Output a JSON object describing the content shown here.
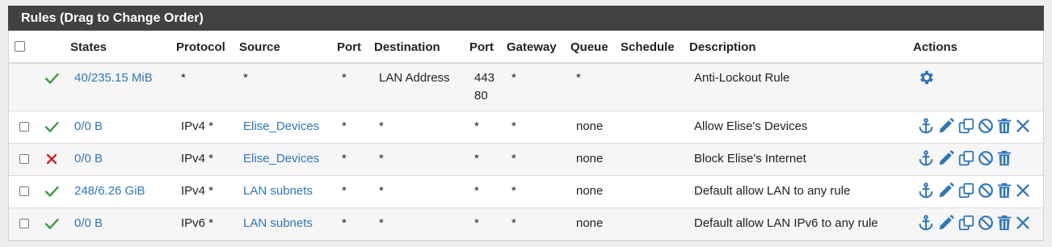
{
  "panel": {
    "title": "Rules (Drag to Change Order)"
  },
  "columns": {
    "states": "States",
    "protocol": "Protocol",
    "source": "Source",
    "port": "Port",
    "destination": "Destination",
    "dest_port": "Port",
    "gateway": "Gateway",
    "queue": "Queue",
    "schedule": "Schedule",
    "description": "Description",
    "actions": "Actions"
  },
  "colors": {
    "header_bg": "#424242",
    "link": "#3176b5",
    "pass": "#3c9a3c",
    "block": "#cc2222",
    "action_icon": "#3176b5"
  },
  "rows": [
    {
      "status": "pass",
      "states": "40/235.15 MiB",
      "protocol": "*",
      "source": "*",
      "port": "*",
      "destination": "LAN Address",
      "dest_port_1": "443",
      "dest_port_2": "80",
      "gateway": "*",
      "queue": "*",
      "schedule": "",
      "description": "Anti-Lockout Rule",
      "actions": [
        "gear-icon"
      ]
    },
    {
      "status": "pass",
      "states": "0/0 B",
      "protocol": "IPv4 *",
      "source": "Elise_Devices",
      "port": "*",
      "destination": "*",
      "dest_port": "*",
      "gateway": "*",
      "queue": "none",
      "schedule": "",
      "description": "Allow Elise's Devices",
      "actions": [
        "anchor-icon",
        "pencil-icon",
        "copy-icon",
        "disable-icon",
        "trash-icon",
        "delete-x-icon"
      ]
    },
    {
      "status": "block",
      "states": "0/0 B",
      "protocol": "IPv4 *",
      "source": "Elise_Devices",
      "port": "*",
      "destination": "*",
      "dest_port": "*",
      "gateway": "*",
      "queue": "none",
      "schedule": "",
      "description": "Block Elise's Internet",
      "actions": [
        "anchor-icon",
        "pencil-icon",
        "copy-icon",
        "disable-icon",
        "trash-icon"
      ]
    },
    {
      "status": "pass",
      "states": "248/6.26 GiB",
      "protocol": "IPv4 *",
      "source": "LAN subnets",
      "port": "*",
      "destination": "*",
      "dest_port": "*",
      "gateway": "*",
      "queue": "none",
      "schedule": "",
      "description": "Default allow LAN to any rule",
      "actions": [
        "anchor-icon",
        "pencil-icon",
        "copy-icon",
        "disable-icon",
        "trash-icon",
        "delete-x-icon"
      ]
    },
    {
      "status": "pass",
      "states": "0/0 B",
      "protocol": "IPv6 *",
      "source": "LAN subnets",
      "port": "*",
      "destination": "*",
      "dest_port": "*",
      "gateway": "*",
      "queue": "none",
      "schedule": "",
      "description": "Default allow LAN IPv6 to any rule",
      "actions": [
        "anchor-icon",
        "pencil-icon",
        "copy-icon",
        "disable-icon",
        "trash-icon",
        "delete-x-icon"
      ]
    }
  ]
}
